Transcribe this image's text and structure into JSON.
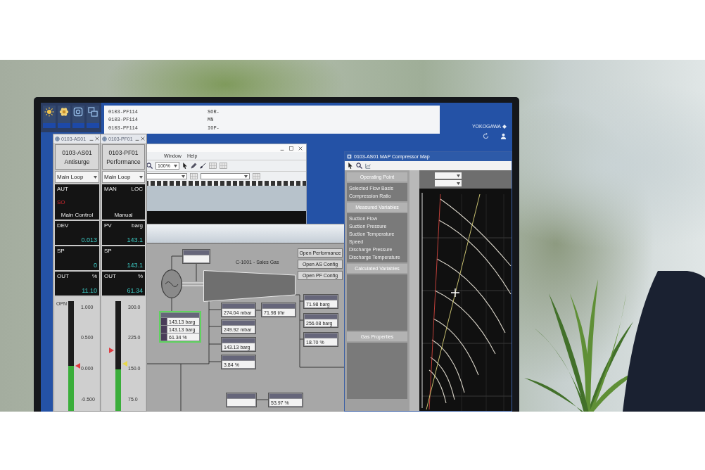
{
  "alarm_banner": {
    "rows": [
      {
        "tag": "0103-PF114",
        "message": "SOR-"
      },
      {
        "tag": "0103-PF114",
        "message": "MN"
      },
      {
        "tag": "0103-PF114",
        "message": "IOP-"
      }
    ]
  },
  "header": {
    "logo": "YOKOGAWA"
  },
  "faceplates": [
    {
      "window_title": "0103-AS01",
      "tag": "0103-AS01",
      "description": "Antisurge",
      "loop": "Main Loop",
      "mode": "AUT",
      "alarm": "SO",
      "mode_label": "Main Control",
      "readouts": [
        {
          "label": "DEV",
          "value": "0.013"
        },
        {
          "label": "SP",
          "value": "0"
        },
        {
          "label": "OUT",
          "unit": "%",
          "value": "11.10"
        }
      ],
      "scale_label": "OPN",
      "ticks": [
        "1.000",
        "0.500",
        "0.000",
        "-0.500"
      ],
      "level": 0.41,
      "markers": [
        {
          "kind": "right",
          "color": "#e0393e",
          "level": 0.41
        }
      ]
    },
    {
      "window_title": "0103-PF01",
      "tag": "0103-PF01",
      "description": "Performance",
      "loop": "Main Loop",
      "mode": "MAN",
      "location": "LOC",
      "mode_label": "Manual",
      "readouts": [
        {
          "label": "PV",
          "unit": "barg",
          "value": "143.1"
        },
        {
          "label": "SP",
          "value": "143.1"
        },
        {
          "label": "OUT",
          "unit": "%",
          "value": "61.34"
        }
      ],
      "ticks": [
        "300.0",
        "225.0",
        "150.0",
        "75.0"
      ],
      "level": 0.38,
      "markers": [
        {
          "kind": "left",
          "color": "#e0393e",
          "level": 0.55
        },
        {
          "kind": "right",
          "color": "#e8d84a",
          "level": 0.43
        }
      ]
    }
  ],
  "graphic_builder": {
    "menus": [
      "Window",
      "Help"
    ],
    "zoom": "100%"
  },
  "process_graphic": {
    "title": "C-1001 - Sales Gas",
    "buttons": [
      "Open Performance",
      "Open AS Config",
      "Open PF Config"
    ],
    "tag_boxes": [
      {
        "selected": false
      },
      {
        "selected": true,
        "rows": [
          {
            "value": "143.13",
            "unit": "barg"
          },
          {
            "value": "143.13",
            "unit": "barg"
          },
          {
            "value": "61.34",
            "unit": "%"
          }
        ]
      },
      {
        "selected": false,
        "rows": [
          {
            "value": "274.04",
            "unit": "mbar"
          }
        ]
      },
      {
        "selected": false,
        "rows": [
          {
            "value": "249.92",
            "unit": "mbar"
          }
        ]
      },
      {
        "selected": false,
        "rows": [
          {
            "value": "143.13",
            "unit": "barg"
          }
        ]
      },
      {
        "selected": false,
        "rows": [
          {
            "value": "3.84",
            "unit": "%"
          }
        ]
      },
      {
        "selected": false,
        "rows": [
          {
            "value": "71.98",
            "unit": "t/hr"
          }
        ]
      },
      {
        "selected": false,
        "rows": [
          {
            "value": "71.98",
            "unit": "barg"
          }
        ]
      },
      {
        "selected": false,
        "rows": [
          {
            "value": "256.08",
            "unit": "barg"
          }
        ]
      },
      {
        "selected": false,
        "rows": [
          {
            "value": "18.70",
            "unit": "%"
          }
        ]
      },
      {
        "selected": false
      },
      {
        "selected": false,
        "rows": [
          {
            "value": "53.97",
            "unit": "%"
          }
        ]
      }
    ]
  },
  "compressor_map": {
    "title": "0103-AS01 MAP Compressor Map",
    "sections": [
      {
        "title": "Operating Point",
        "rows": [
          "Selected Flow Basis",
          "Compression Ratio"
        ]
      },
      {
        "title": "Measured Variables",
        "rows": [
          "Suction Flow",
          "Suction Pressure",
          "Suction Temperature",
          "Speed",
          "Discharge Pressure",
          "Discharge Temperature"
        ]
      },
      {
        "title": "Calculated Variables"
      },
      {
        "title": "Gas Properties"
      }
    ]
  }
}
